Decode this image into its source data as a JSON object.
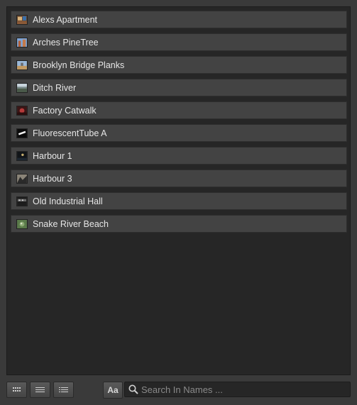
{
  "library": {
    "items": [
      {
        "label": "Alexs Apartment",
        "icon": "thumbnail-apartment"
      },
      {
        "label": "Arches PineTree",
        "icon": "thumbnail-arches"
      },
      {
        "label": "Brooklyn Bridge Planks",
        "icon": "thumbnail-bridge"
      },
      {
        "label": "Ditch River",
        "icon": "thumbnail-river"
      },
      {
        "label": "Factory Catwalk",
        "icon": "thumbnail-factory"
      },
      {
        "label": "FluorescentTube A",
        "icon": "thumbnail-tube"
      },
      {
        "label": "Harbour 1",
        "icon": "thumbnail-harbour"
      },
      {
        "label": "Harbour 3",
        "icon": "thumbnail-harbour"
      },
      {
        "label": "Old Industrial Hall",
        "icon": "thumbnail-hall"
      },
      {
        "label": "Snake River Beach",
        "icon": "thumbnail-beach"
      }
    ]
  },
  "toolbar": {
    "view_buttons": [
      "grid-view-icon",
      "list-view-icon",
      "detail-view-icon"
    ],
    "match_case_label": "Aa",
    "search_placeholder": "Search In Names ..."
  },
  "colors": {
    "background": "#3a3a3a",
    "panel": "#262626",
    "item": "#434343",
    "text": "#e6e6e6"
  }
}
